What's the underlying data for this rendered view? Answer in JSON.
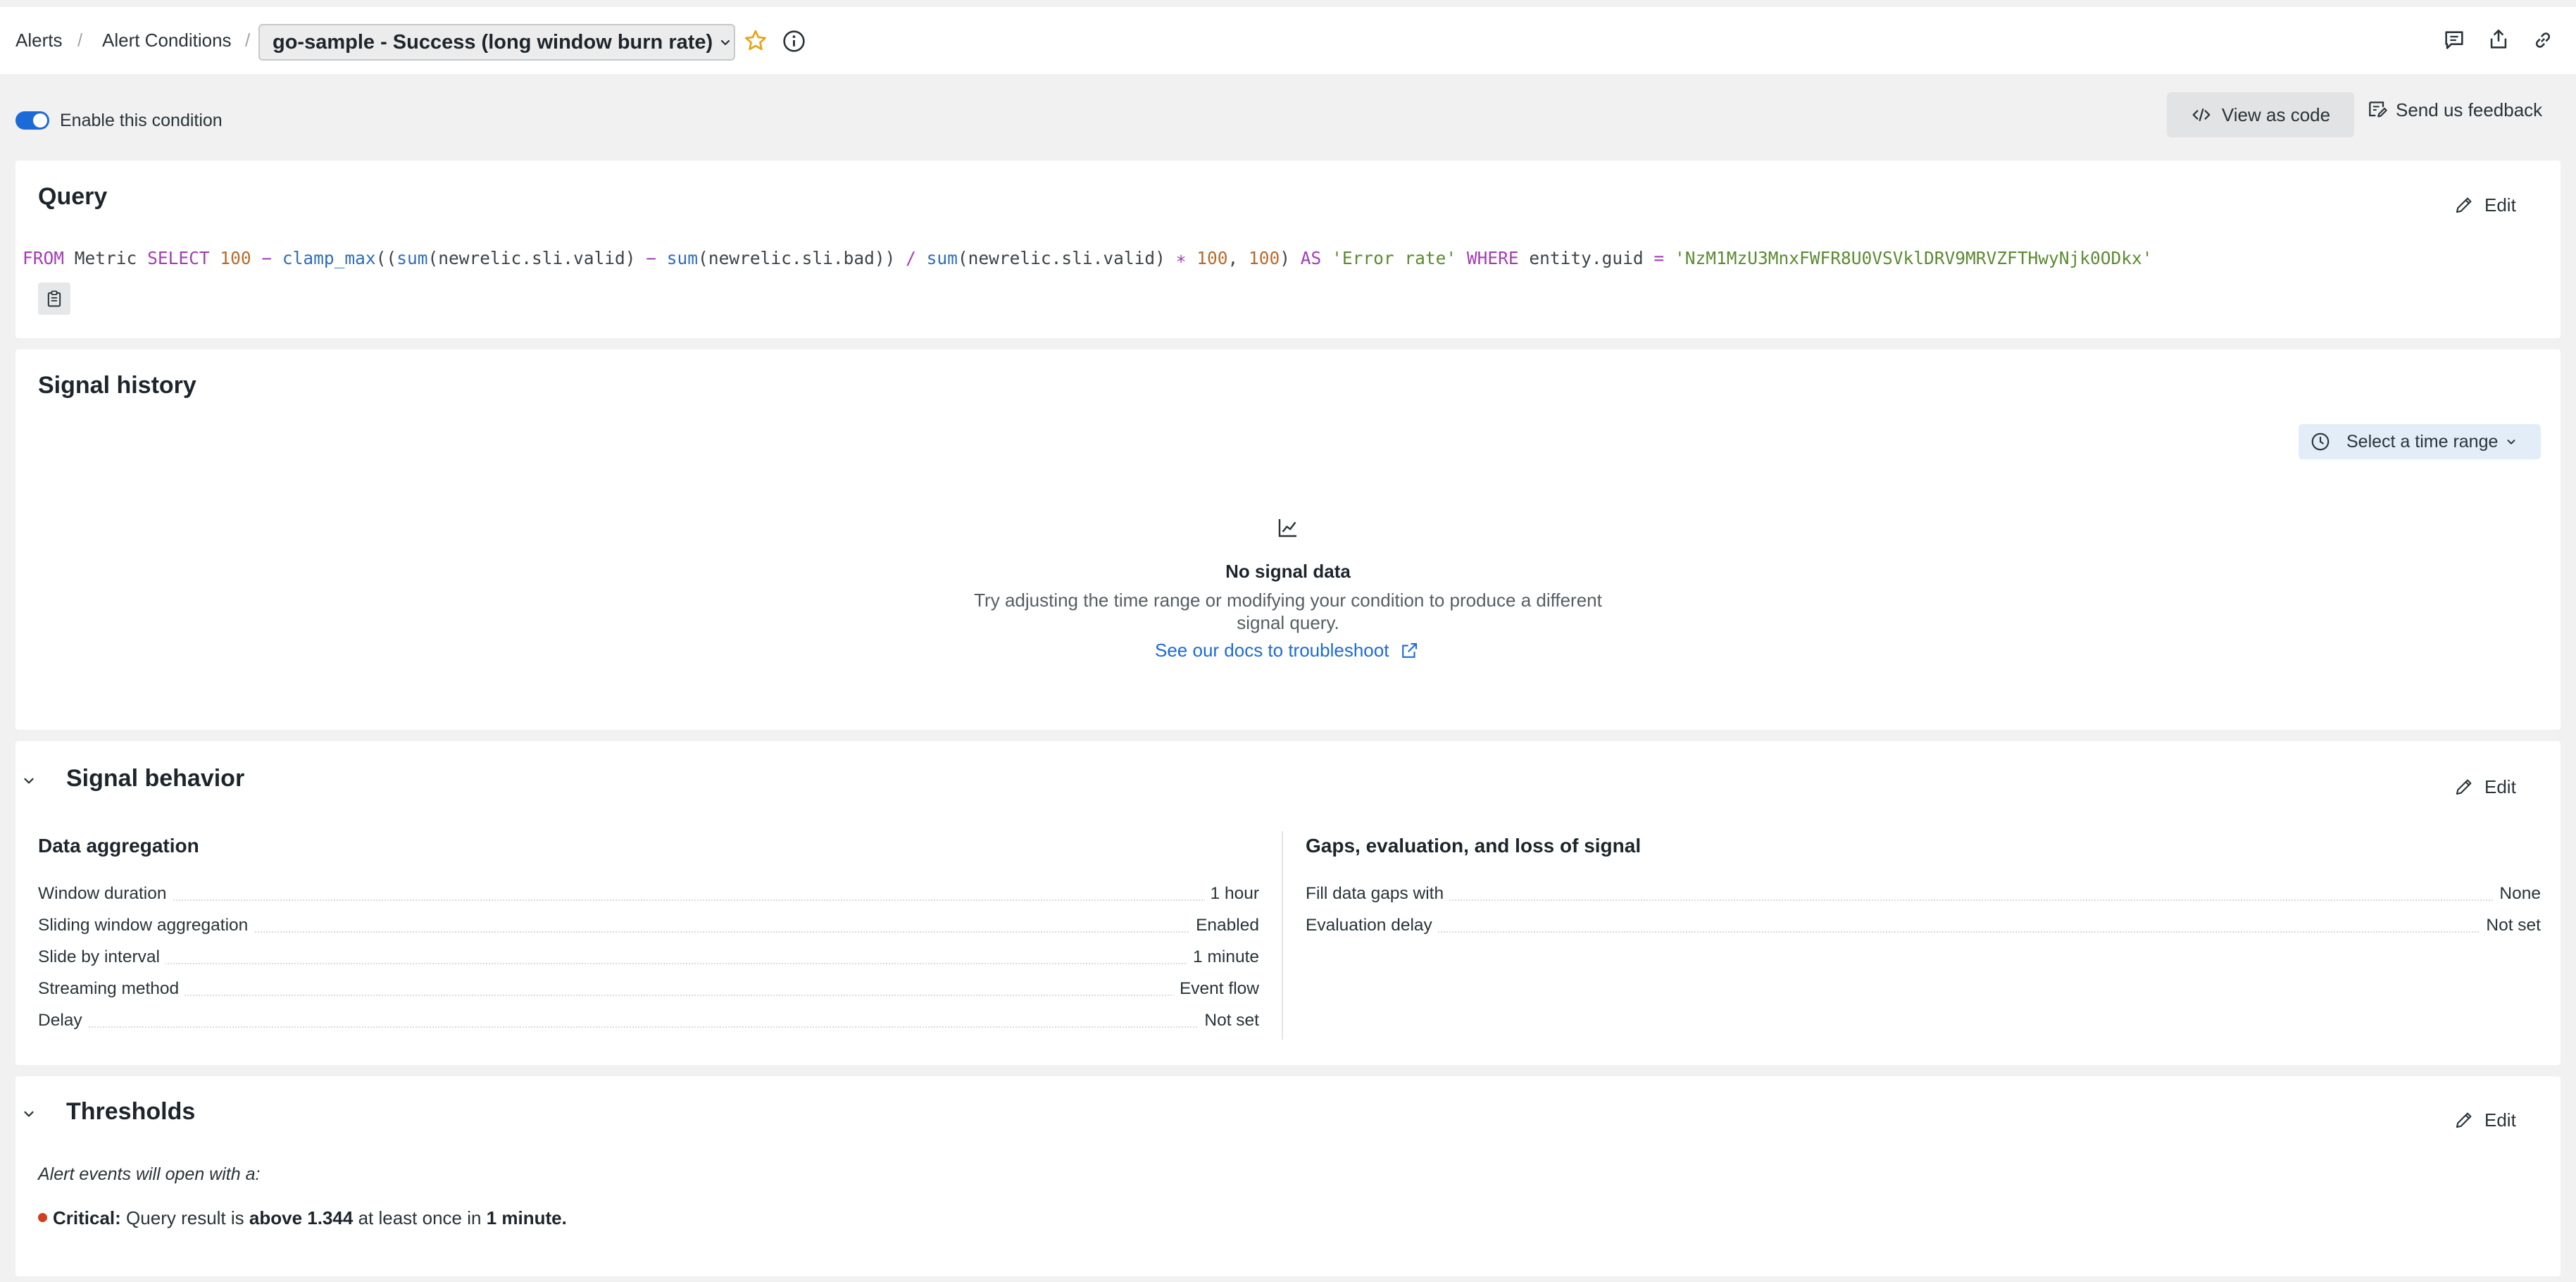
{
  "header": {
    "breadcrumbs": [
      "Alerts",
      "Alert Conditions"
    ],
    "title": "go-sample - Success (long window burn rate)"
  },
  "toolbar": {
    "enable_label": "Enable this condition",
    "enabled": true,
    "view_code_label": "View as code",
    "feedback_label": "Send us feedback"
  },
  "query": {
    "title": "Query",
    "edit_label": "Edit",
    "tokens": {
      "from": "FROM",
      "metric": "Metric",
      "select": "SELECT",
      "n100": "100",
      "minus": "−",
      "clamp": "clamp_max",
      "sum": "sum",
      "valid": "newrelic.sli.valid",
      "bad": "newrelic.sli.bad",
      "div": "/",
      "mul": "∗",
      "as": "AS",
      "alias": "'Error rate'",
      "where": "WHERE",
      "guid_field": "entity.guid",
      "eq": "=",
      "guid": "'NzM1MzU3MnxFWFR8U0VSVklDRV9MRVZFTHwyNjk0ODkx'"
    }
  },
  "signal_history": {
    "title": "Signal history",
    "range_label": "Select a time range",
    "empty_title": "No signal data",
    "empty_text": "Try adjusting the time range or modifying your condition to produce a different signal query.",
    "docs_link": "See our docs to troubleshoot"
  },
  "signal_behavior": {
    "title": "Signal behavior",
    "edit_label": "Edit",
    "aggregation": {
      "title": "Data aggregation",
      "rows": [
        {
          "label": "Window duration",
          "value": "1 hour"
        },
        {
          "label": "Sliding window aggregation",
          "value": "Enabled"
        },
        {
          "label": "Slide by interval",
          "value": "1 minute"
        },
        {
          "label": "Streaming method",
          "value": "Event flow"
        },
        {
          "label": "Delay",
          "value": "Not set"
        }
      ]
    },
    "gaps": {
      "title": "Gaps, evaluation, and loss of signal",
      "rows": [
        {
          "label": "Fill data gaps with",
          "value": "None"
        },
        {
          "label": "Evaluation delay",
          "value": "Not set"
        }
      ]
    }
  },
  "thresholds": {
    "title": "Thresholds",
    "edit_label": "Edit",
    "intro": "Alert events will open with a:",
    "critical_label": "Critical:",
    "text1": "Query result is",
    "condition": "above 1.344",
    "text2": "at least once in",
    "duration": "1 minute."
  },
  "colors": {
    "accent": "#1c6ad8",
    "critical": "#d0401f",
    "star": "#e8a317",
    "code_keyword": "#a43db5",
    "code_function": "#2f6dbd",
    "code_number": "#b96a2b",
    "code_string": "#5c8b32"
  },
  "icons": [
    "star-icon",
    "info-icon",
    "comment-icon",
    "share-icon",
    "link-icon",
    "code-icon",
    "feedback-icon",
    "pencil-icon",
    "clipboard-icon",
    "clock-icon",
    "chart-icon",
    "external-link-icon",
    "chevron-down-icon"
  ]
}
